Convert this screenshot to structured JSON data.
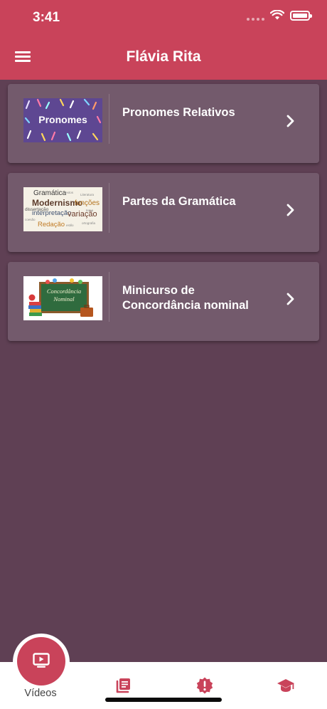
{
  "status_bar": {
    "time": "3:41"
  },
  "header": {
    "title": "Flávia Rita"
  },
  "items": [
    {
      "title": "Pronomes Relativos",
      "thumb_label": "Pronomes"
    },
    {
      "title": "Partes da Gramática",
      "thumb_words": [
        "Gramática",
        "Modernismo",
        "funções",
        "interpretação",
        "variação",
        "dissertação",
        "Redação"
      ]
    },
    {
      "title": "Minicurso de Concordância nominal",
      "thumb_words": [
        "Concordância",
        "Nominal"
      ]
    }
  ],
  "bottom_nav": {
    "active_label": "Vídeos",
    "tabs": [
      {
        "icon": "tv-play-icon",
        "label": "Vídeos"
      },
      {
        "icon": "articles-icon"
      },
      {
        "icon": "alert-badge-icon"
      },
      {
        "icon": "graduation-cap-icon"
      }
    ]
  },
  "colors": {
    "primary": "#c9435a",
    "background": "#5f4054",
    "card": "#735a6c"
  }
}
